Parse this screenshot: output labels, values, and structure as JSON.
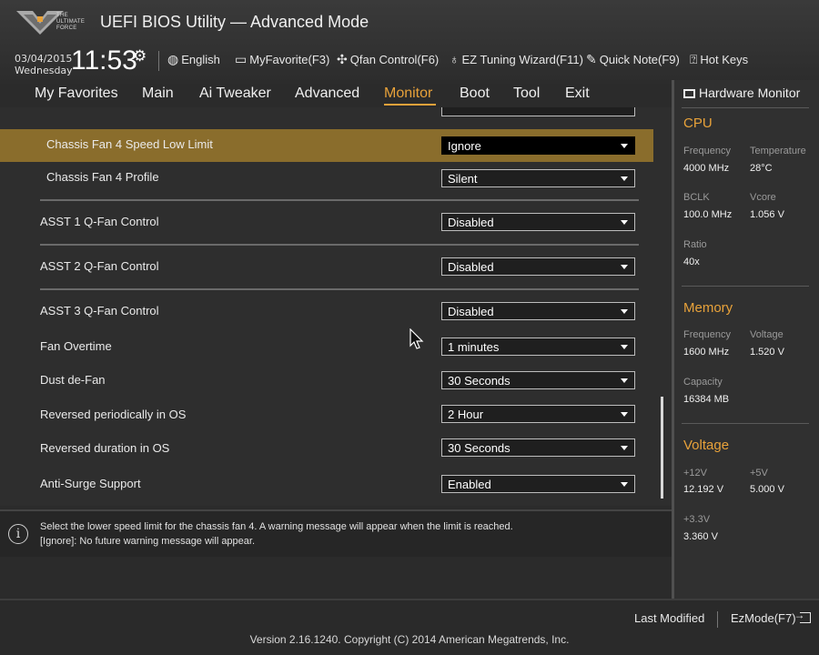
{
  "header": {
    "logo_text": [
      "THE",
      "ULTIMATE",
      "FORCE"
    ],
    "title": "UEFI BIOS Utility — Advanced Mode",
    "date": "03/04/2015",
    "weekday": "Wednesday",
    "time": "11:53",
    "toolbar": [
      {
        "label": "English",
        "icon": "globe-icon"
      },
      {
        "label": "MyFavorite(F3)",
        "icon": "favorite-window-icon"
      },
      {
        "label": "Qfan Control(F6)",
        "icon": "fan-icon"
      },
      {
        "label": "EZ Tuning Wizard(F11)",
        "icon": "lightbulb-icon"
      },
      {
        "label": "Quick Note(F9)",
        "icon": "note-icon"
      },
      {
        "label": "Hot Keys",
        "icon": "help-key-icon"
      }
    ]
  },
  "nav": {
    "tabs": [
      "My Favorites",
      "Main",
      "Ai Tweaker",
      "Advanced",
      "Monitor",
      "Boot",
      "Tool",
      "Exit"
    ],
    "active": "Monitor"
  },
  "settings": [
    {
      "label": "Chassis Fan 4 Speed Low Limit",
      "value": "Ignore",
      "highlight": true
    },
    {
      "label": "Chassis Fan 4 Profile",
      "value": "Silent"
    },
    {
      "label": "ASST 1 Q-Fan Control",
      "value": "Disabled"
    },
    {
      "label": "ASST 2 Q-Fan Control",
      "value": "Disabled"
    },
    {
      "label": "ASST 3 Q-Fan Control",
      "value": "Disabled"
    },
    {
      "label": "Fan Overtime",
      "value": "1 minutes"
    },
    {
      "label": "Dust de-Fan",
      "value": "30 Seconds"
    },
    {
      "label": "Reversed periodically in OS",
      "value": "2 Hour"
    },
    {
      "label": "Reversed duration in OS",
      "value": "30 Seconds"
    },
    {
      "label": "Anti-Surge Support",
      "value": "Enabled"
    }
  ],
  "help": {
    "line1": "Select the lower speed limit for the chassis fan 4. A warning message will appear when the limit is reached.",
    "line2": "[Ignore]: No future warning message will appear."
  },
  "hardware_monitor": {
    "title": "Hardware Monitor",
    "cpu": {
      "heading": "CPU",
      "frequency_label": "Frequency",
      "frequency": "4000 MHz",
      "temperature_label": "Temperature",
      "temperature": "28°C",
      "bclk_label": "BCLK",
      "bclk": "100.0 MHz",
      "vcore_label": "Vcore",
      "vcore": "1.056 V",
      "ratio_label": "Ratio",
      "ratio": "40x"
    },
    "memory": {
      "heading": "Memory",
      "frequency_label": "Frequency",
      "frequency": "1600 MHz",
      "voltage_label": "Voltage",
      "voltage": "1.520 V",
      "capacity_label": "Capacity",
      "capacity": "16384 MB"
    },
    "voltage": {
      "heading": "Voltage",
      "v12_label": "+12V",
      "v12": "12.192 V",
      "v5_label": "+5V",
      "v5": "5.000 V",
      "v33_label": "+3.3V",
      "v33": "3.360 V"
    }
  },
  "footer": {
    "last_modified": "Last Modified",
    "ezmode": "EzMode(F7)",
    "version": "Version 2.16.1240. Copyright (C) 2014 American Megatrends, Inc."
  },
  "colors": {
    "accent": "#e8a23a",
    "highlight_row": "#8a6d2c"
  }
}
